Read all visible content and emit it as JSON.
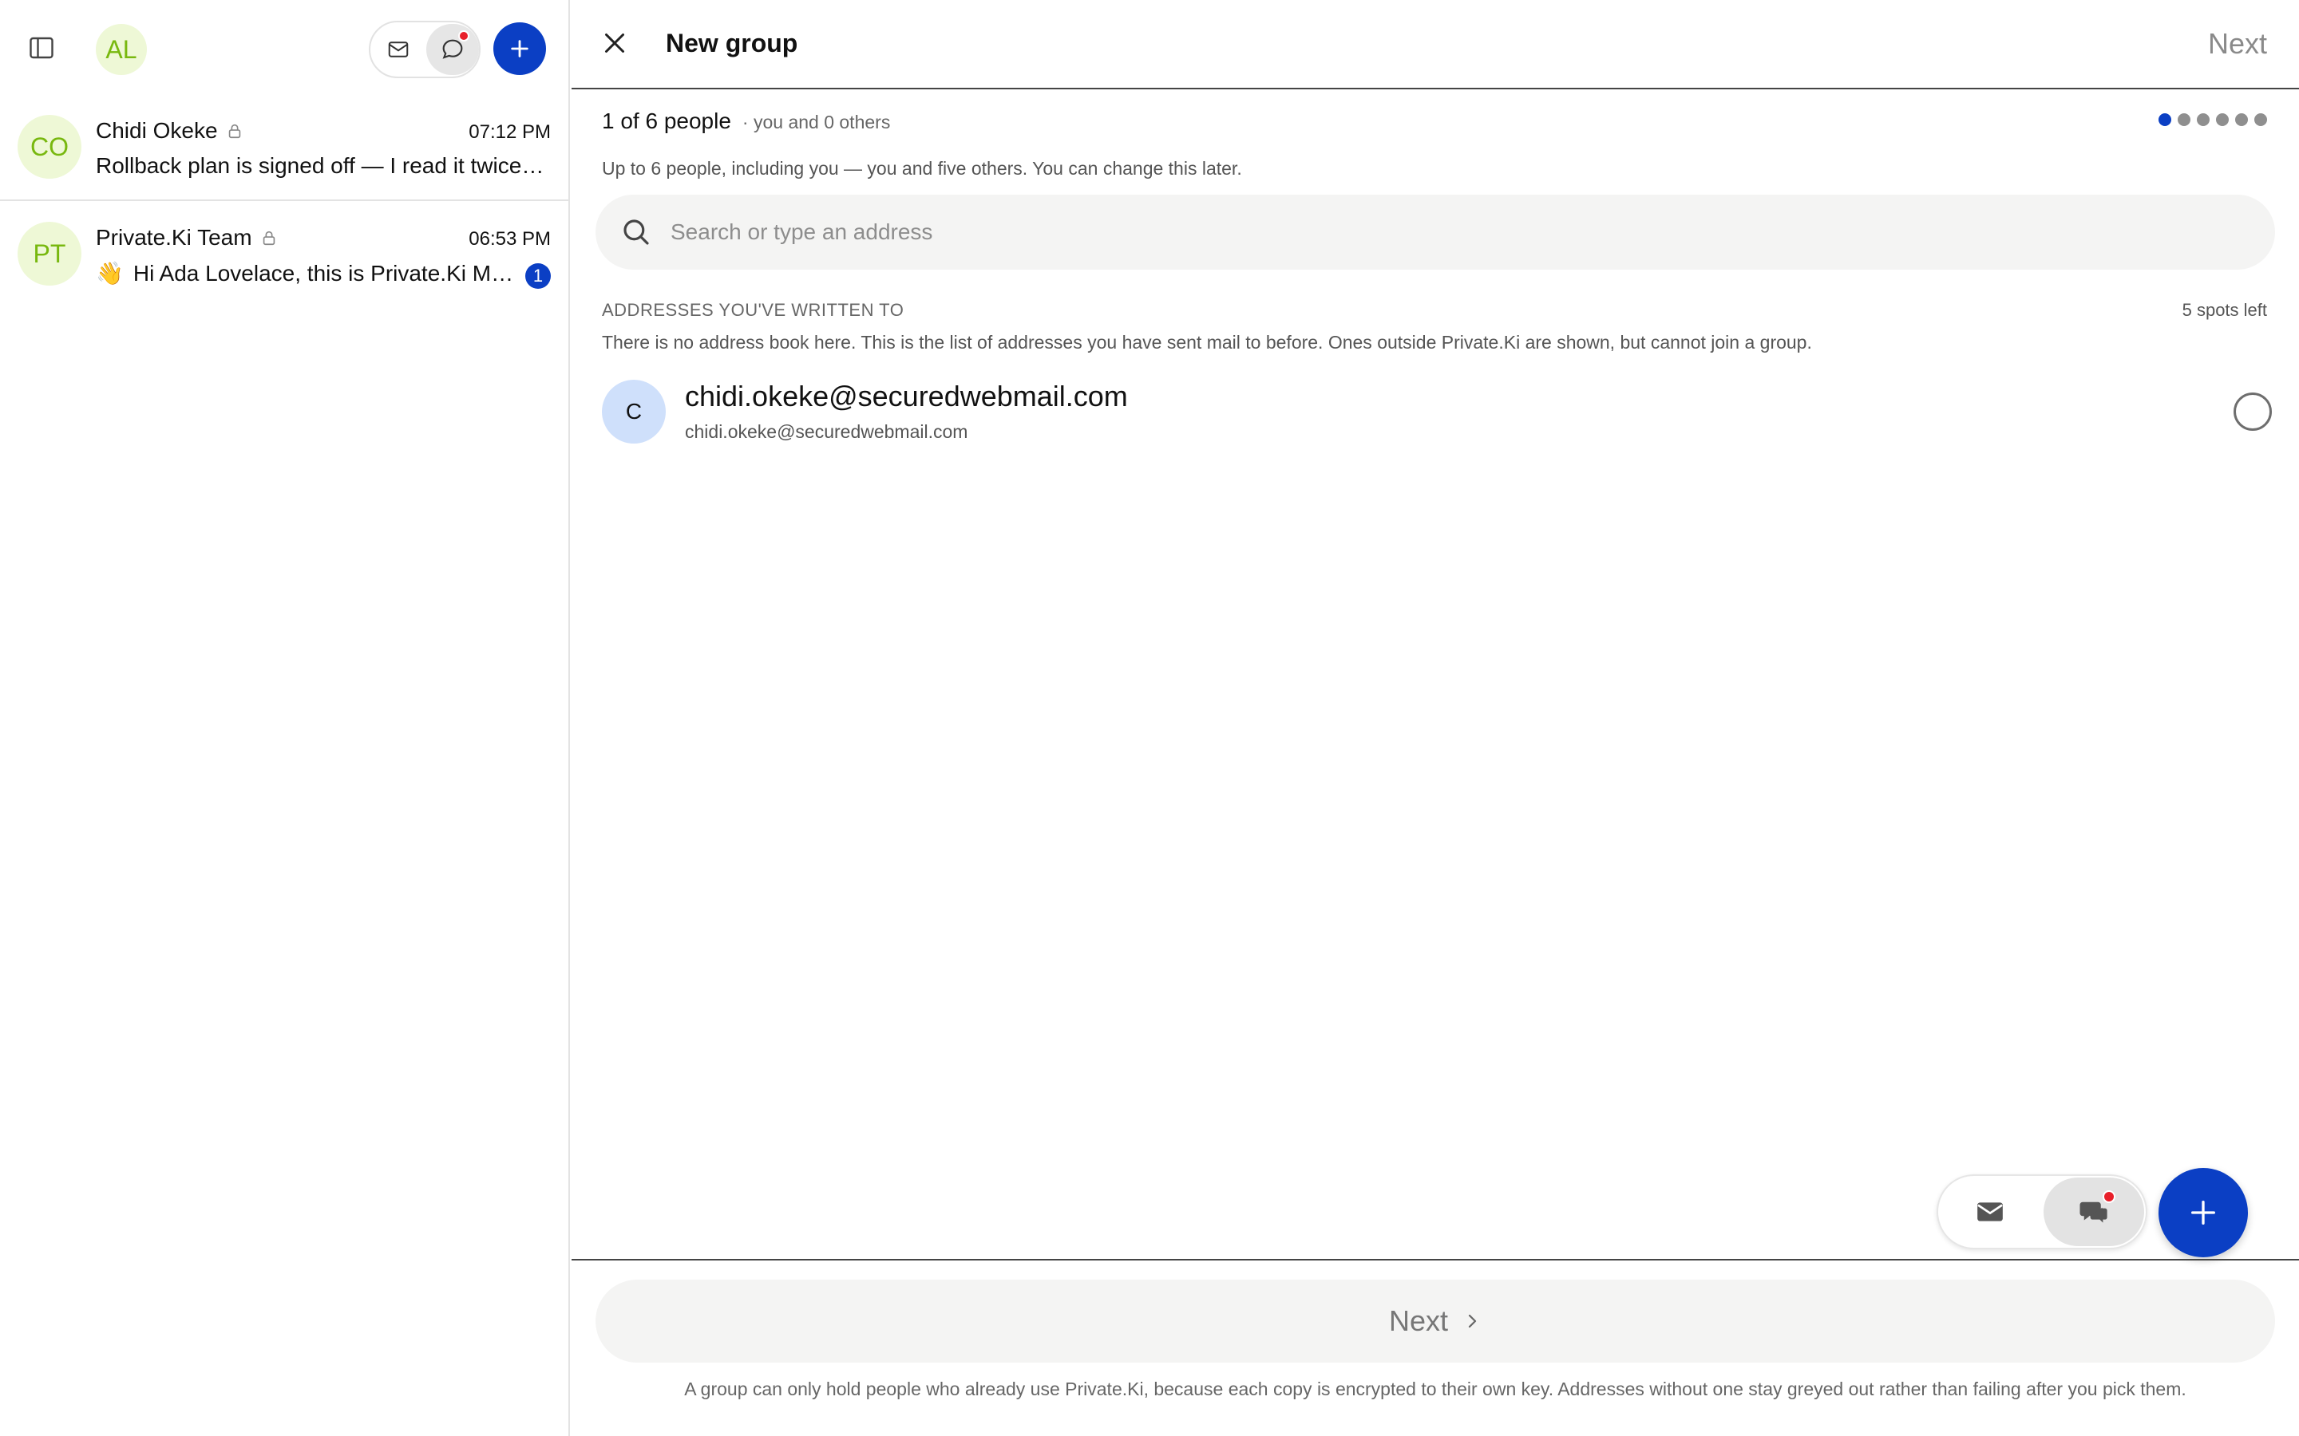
{
  "sidebar": {
    "user_initials": "AL",
    "conversations": [
      {
        "initials": "CO",
        "name": "Chidi Okeke",
        "time": "07:12 PM",
        "preview": "Rollback plan is signed off — I read it twice. …"
      },
      {
        "initials": "PT",
        "name": "Private.Ki Team",
        "time": "06:53 PM",
        "emoji": "👋",
        "preview": "Hi Ada Lovelace, this is Private.Ki Me…",
        "unread": "1"
      }
    ]
  },
  "header": {
    "title": "New group",
    "next_label": "Next"
  },
  "group": {
    "count_label": "1 of 6 people",
    "count_detail": "· you and 0 others",
    "subtitle": "Up to 6 people, including you — you and five others. You can change this later.",
    "steps_total": 6,
    "steps_filled": 1
  },
  "search": {
    "placeholder": "Search or type an address",
    "value": ""
  },
  "addresses": {
    "heading": "ADDRESSES YOU'VE WRITTEN TO",
    "spots_left": "5 spots left",
    "note": "There is no address book here. This is the list of addresses you have sent mail to before. Ones outside Private.Ki are shown, but cannot join a group.",
    "items": [
      {
        "initial": "C",
        "name": "chidi.okeke@securedwebmail.com",
        "address": "chidi.okeke@securedwebmail.com"
      }
    ]
  },
  "footer": {
    "next_label": "Next",
    "note": "A group can only hold people who already use Private.Ki, because each copy is encrypted to their own key. Addresses without one stay greyed out rather than failing after you pick them."
  },
  "colors": {
    "accent": "#0b3fc4",
    "avatar_bg": "#eef8d6",
    "avatar_text": "#78b80f",
    "notification": "#e8202a"
  },
  "icons": {
    "sidebar_toggle": "sidebar-toggle-icon",
    "mail": "mail-icon",
    "chat": "chat-icon",
    "plus": "plus-icon",
    "lock": "lock-icon",
    "close": "close-icon",
    "search": "search-icon",
    "chevron": "chevron-right-icon"
  }
}
